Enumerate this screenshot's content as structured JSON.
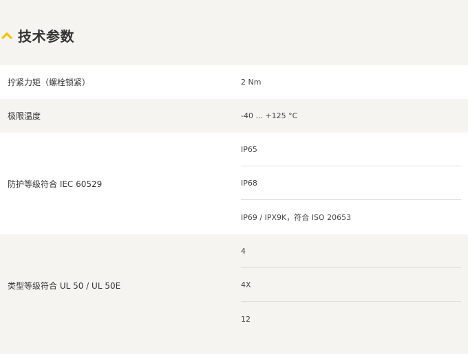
{
  "section": {
    "title": "技术参数",
    "accent_color": "#f2c200",
    "icon": "chevron-up-icon"
  },
  "rows": [
    {
      "label": "拧紧力矩（螺栓锁紧）",
      "values": [
        " 2 Nm"
      ]
    },
    {
      "label": "极限温度",
      "values": [
        "-40 ... +125 °C"
      ]
    },
    {
      "label": "防护等级符合 IEC 60529",
      "values": [
        "IP65",
        "IP68",
        "IP69 / IPX9K，符合 ISO 20653"
      ]
    },
    {
      "label": "类型等级符合 UL 50 / UL 50E",
      "values": [
        "4",
        "4X",
        "12"
      ]
    }
  ]
}
